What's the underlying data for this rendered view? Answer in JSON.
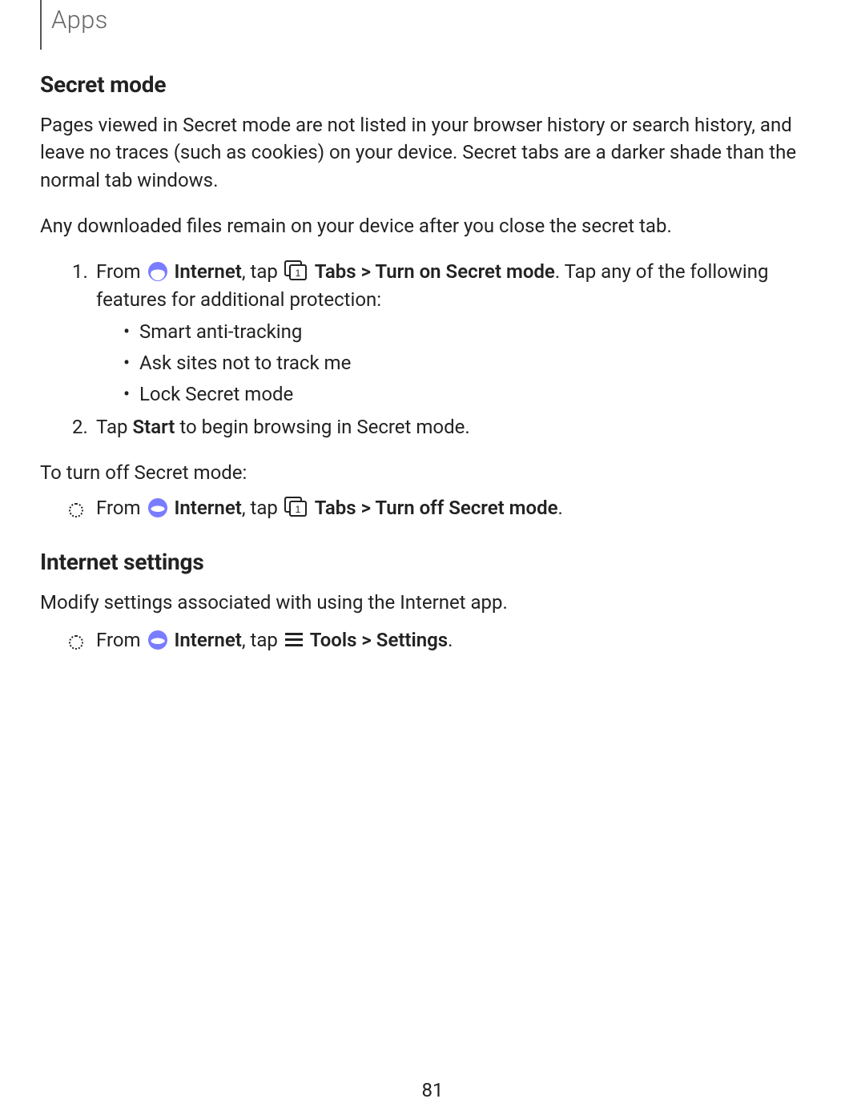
{
  "breadcrumb": "Apps",
  "page_number": "81",
  "sections": {
    "secret_mode": {
      "heading": "Secret mode",
      "para1": "Pages viewed in Secret mode are not listed in your browser history or search history, and leave no traces (such as cookies) on your device. Secret tabs are a darker shade than the normal tab windows.",
      "para2": "Any downloaded files remain on your device after you close the secret tab.",
      "step1": {
        "num": "1.",
        "pre": "From ",
        "app": "Internet",
        "after_app": ", tap ",
        "tabs_path": "Tabs > Turn on Secret mode",
        "tail": ". Tap any of the following features for additional protection:"
      },
      "bullets": [
        "Smart anti-tracking",
        "Ask sites not to track me",
        "Lock Secret mode"
      ],
      "step2": {
        "num": "2.",
        "pre": "Tap ",
        "start": "Start",
        "tail": " to begin browsing in Secret mode."
      },
      "turn_off_intro": "To turn off Secret mode:",
      "turn_off_step": {
        "pre": "From ",
        "app": "Internet",
        "after_app": ", tap ",
        "tabs_path": "Tabs > Turn off Secret mode",
        "tail": "."
      }
    },
    "internet_settings": {
      "heading": "Internet settings",
      "para": "Modify settings associated with using the Internet app.",
      "step": {
        "pre": "From ",
        "app": "Internet",
        "after_app": ", tap ",
        "tools_path": "Tools > Settings",
        "tail": "."
      }
    }
  }
}
